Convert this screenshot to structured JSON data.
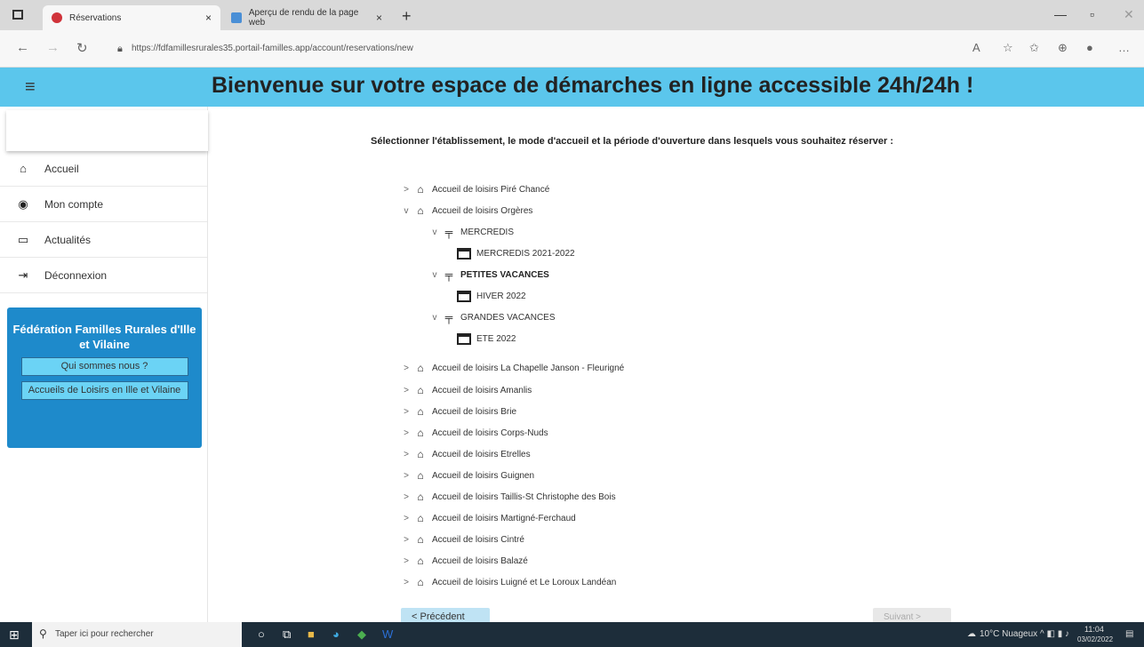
{
  "browser": {
    "tabs": [
      {
        "title": "Réservations",
        "active": true,
        "close": "×"
      },
      {
        "title": "Aperçu de rendu de la page web",
        "active": false,
        "close": "×"
      }
    ],
    "new_tab": "+",
    "url": "https://fdfamillesrurales35.portail-familles.app/account/reservations/new"
  },
  "header": {
    "menu_icon": "≡",
    "title": "Bienvenue sur votre espace de démarches en ligne accessible 24h/24h !",
    "color": "#5bc6ec"
  },
  "sidebar": {
    "items": [
      {
        "label": "Accueil",
        "icon": "home-icon"
      },
      {
        "label": "Mon compte",
        "icon": "account-icon"
      },
      {
        "label": "Actualités",
        "icon": "news-icon"
      },
      {
        "label": "Déconnexion",
        "icon": "logout-icon"
      }
    ],
    "promo": {
      "title": "Fédération Familles Rurales d'Ille et Vilaine",
      "buttons": [
        "Qui sommes nous ?",
        "Accueils de Loisirs en Ille et Vilaine"
      ]
    }
  },
  "main": {
    "instruction": "Sélectionner l'établissement, le mode d'accueil et la période d'ouverture dans lesquels vous souhaitez réserver :",
    "tree": [
      "Accueil de loisirs Piré Chancé",
      "Accueil de loisirs Orgères",
      "MERCREDIS",
      "MERCREDIS 2021-2022",
      "PETITES VACANCES",
      "HIVER 2022",
      "GRANDES VACANCES",
      "ETE 2022",
      "Accueil de loisirs La Chapelle Janson - Fleurigné",
      "Accueil de loisirs Amanlis",
      "Accueil de loisirs Brie",
      "Accueil de loisirs Corps-Nuds",
      "Accueil de loisirs Etrelles",
      "Accueil de loisirs Guignen",
      "Accueil de loisirs Taillis-St Christophe des Bois",
      "Accueil de loisirs Martigné-Ferchaud",
      "Accueil de loisirs Cintré",
      "Accueil de loisirs Balazé",
      "Accueil de loisirs Luigné et Le Loroux Landéan"
    ],
    "prev_button": "< Précédent",
    "next_button": "Suivant >"
  },
  "taskbar": {
    "search_placeholder": "Taper ici pour rechercher",
    "weather": "10°C Nuageux",
    "time": "11:04",
    "date": "03/02/2022"
  }
}
